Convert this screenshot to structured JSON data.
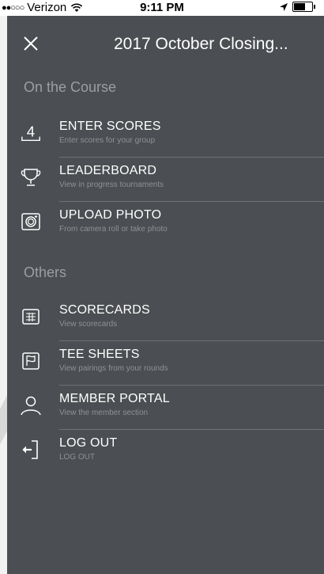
{
  "status_bar": {
    "signal": "●●○○○",
    "carrier": "Verizon",
    "time": "9:11 PM"
  },
  "header": {
    "title": "2017 October Closing..."
  },
  "sections": [
    {
      "label": "On the Course",
      "items": [
        {
          "label": "ENTER SCORES",
          "sub": "Enter scores for your group",
          "icon": "score-entry-icon",
          "glyph": "4"
        },
        {
          "label": "LEADERBOARD",
          "sub": "View in progress tournaments",
          "icon": "trophy-icon"
        },
        {
          "label": "UPLOAD PHOTO",
          "sub": "From camera roll or take photo",
          "icon": "camera-icon"
        }
      ]
    },
    {
      "label": "Others",
      "items": [
        {
          "label": "SCORECARDS",
          "sub": "View scorecards",
          "icon": "scorecard-grid-icon"
        },
        {
          "label": "TEE SHEETS",
          "sub": "View pairings from your rounds",
          "icon": "flag-icon"
        },
        {
          "label": "MEMBER PORTAL",
          "sub": "View the member section",
          "icon": "person-icon"
        },
        {
          "label": "LOG OUT",
          "sub": "LOG OUT",
          "icon": "logout-icon"
        }
      ]
    }
  ],
  "colors": {
    "drawer_bg": "#4b4e52",
    "section_label": "#9b9ea2",
    "subtitle": "#8e9195",
    "divider": "#6f7276"
  }
}
